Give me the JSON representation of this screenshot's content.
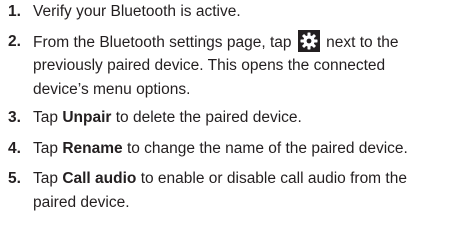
{
  "steps": [
    {
      "number": "1.",
      "text": "Verify your Bluetooth is active."
    },
    {
      "number": "2.",
      "before_icon": "From the Bluetooth settings page, tap",
      "icon": "gear-icon",
      "after_icon": "next to the",
      "line2": "previously paired device. This opens the connected",
      "line3": "device’s menu options."
    },
    {
      "number": "3.",
      "prefix": "Tap",
      "action": "Unpair",
      "suffix": "to delete the paired device."
    },
    {
      "number": "4.",
      "prefix": "Tap",
      "action": "Rename",
      "suffix": "to change the name of the paired device."
    },
    {
      "number": "5.",
      "prefix": "Tap",
      "action": "Call audio",
      "suffix": "to enable or disable call audio from the",
      "line2": "paired device."
    }
  ],
  "colors": {
    "text": "#231f20",
    "icon_background": "#231f20",
    "icon_foreground": "#ffffff"
  }
}
